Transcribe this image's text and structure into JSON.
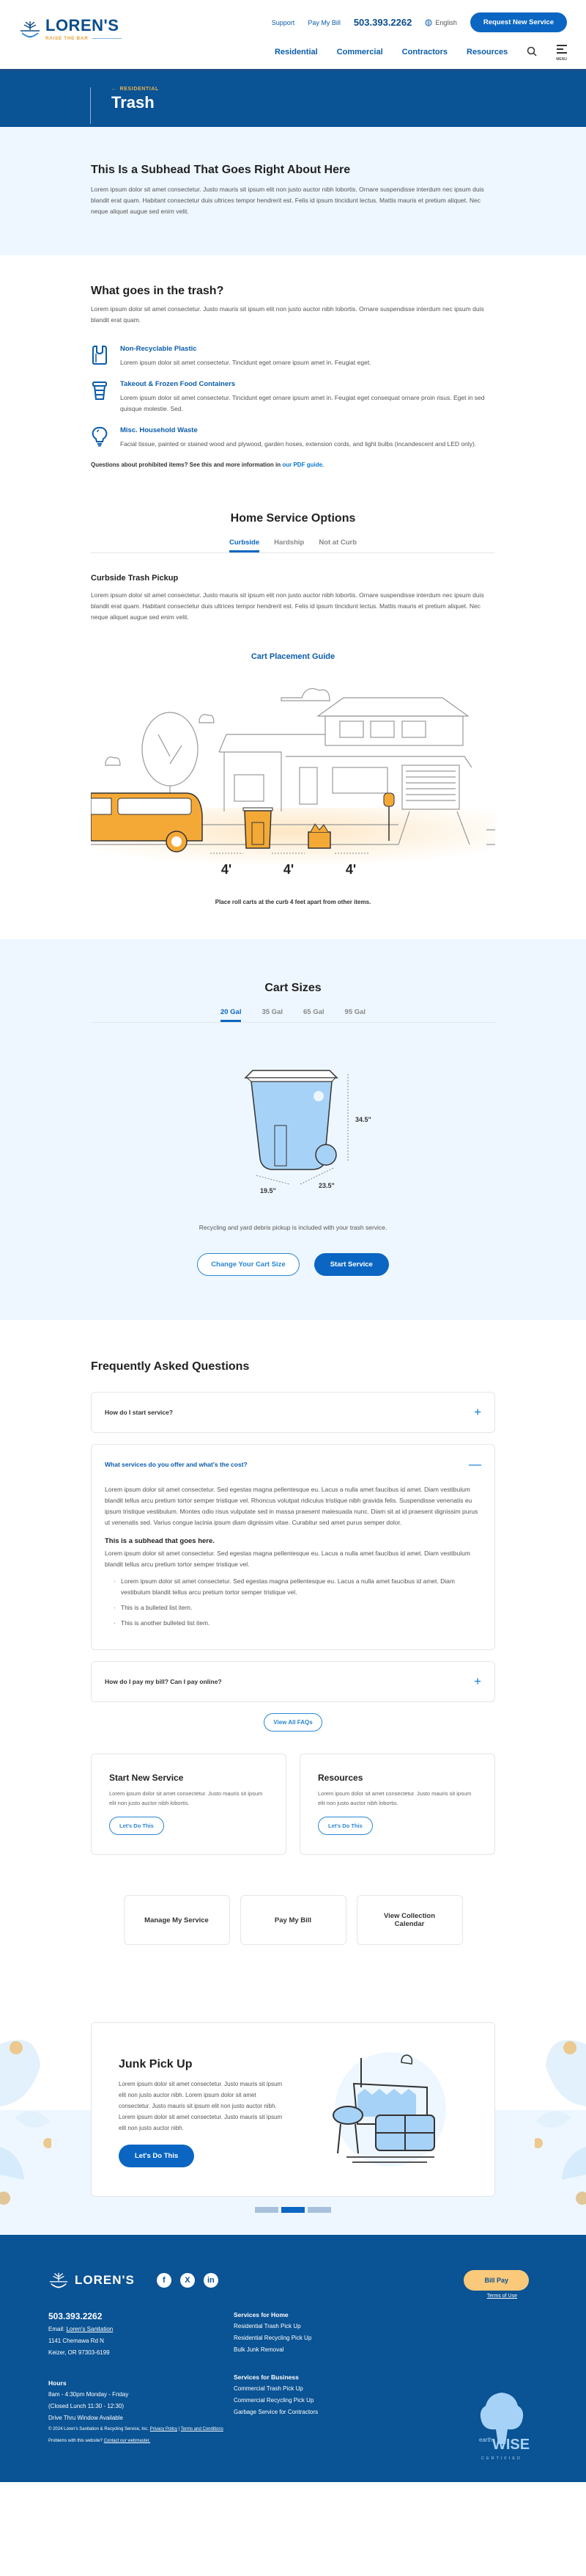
{
  "header": {
    "brand": "LOREN'S",
    "tagline": "RAISE THE BAR",
    "util_links": [
      "Support",
      "Pay My Bill"
    ],
    "phone": "503.393.2262",
    "language": "English",
    "cta": "Request New Service",
    "nav": [
      "Residential",
      "Commercial",
      "Contractors",
      "Resources"
    ],
    "menu_label": "MENU"
  },
  "hero": {
    "breadcrumb": "RESIDENTIAL",
    "title": "Trash"
  },
  "intro": {
    "heading": "This Is a Subhead That Goes Right About Here",
    "body": "Lorem ipsum dolor sit amet consectetur. Justo mauris sit ipsum elit non justo auctor nibh lobortis. Ornare suspendisse interdum nec ipsum duis blandit erat quam. Habitant consectetur duis ultrices tempor hendrerit est. Felis id ipsum tincidunt lectus. Mattis mauris et pretium aliquet. Nec neque aliquet augue sed enim velit."
  },
  "what_goes": {
    "heading": "What goes in the trash?",
    "body": "Lorem ipsum dolor sit amet consectetur. Justo mauris sit ipsum elit non justo auctor nibh lobortis. Ornare suspendisse interdum nec ipsum duis blandit erat quam.",
    "items": [
      {
        "icon": "plastic-bag-icon",
        "title": "Non-Recyclable Plastic",
        "body": "Lorem ipsum dolor sit amet consectetur. Tincidunt eget ornare ipsum amet in. Feugiat eget."
      },
      {
        "icon": "takeout-cup-icon",
        "title": "Takeout & Frozen Food Containers",
        "body": "Lorem ipsum dolor sit amet consectetur. Tincidunt eget ornare ipsum amet in. Feugiat eget consequat ornare proin risus. Eget in sed quisque molestie. Sed."
      },
      {
        "icon": "lightbulb-icon",
        "title": "Misc. Household Waste",
        "body": "Facial tissue, painted or stained wood and plywood, garden hoses, extension cords, and light bulbs (incandescent and LED only)."
      }
    ],
    "note": "Questions about prohibited items? See this and more information in ",
    "note_link": "our PDF guide."
  },
  "home_service": {
    "heading": "Home Service Options",
    "tabs": [
      "Curbside",
      "Hardship",
      "Not at Curb"
    ],
    "active_tab": "Curbside",
    "subheading": "Curbside Trash Pickup",
    "body": "Lorem ipsum dolor sit amet consectetur. Justo mauris sit ipsum elit non justo auctor nibh lobortis. Ornare suspendisse interdum nec ipsum duis blandit erat quam. Habitant consectetur duis ultrices tempor hendrerit est. Felis id ipsum tincidunt lectus. Mattis mauris et pretium aliquet. Nec neque aliquet augue sed enim velit.",
    "guide_title": "Cart Placement Guide",
    "distance_labels": [
      "4'",
      "4'",
      "4'"
    ],
    "caption": "Place roll carts at the curb 4 feet apart from other items."
  },
  "cart_sizes": {
    "heading": "Cart Sizes",
    "tabs": [
      "20 Gal",
      "35 Gal",
      "65 Gal",
      "95 Gal"
    ],
    "active_tab": "20 Gal",
    "height": "34.5\"",
    "width": "19.5\"",
    "depth": "23.5\"",
    "note": "Recycling and yard debris pickup is included with your trash service.",
    "btn_change": "Change Your Cart Size",
    "btn_start": "Start Service"
  },
  "faq": {
    "heading": "Frequently Asked Questions",
    "items": [
      {
        "q": "How do I start service?",
        "open": false
      },
      {
        "q": "What services do you offer and what's the cost?",
        "open": true
      },
      {
        "q": "How do I pay my bill? Can I pay online?",
        "open": false
      }
    ],
    "open_body": {
      "p1": "Lorem ipsum dolor sit amet consectetur. Sed egestas magna pellentesque eu. Lacus a nulla amet faucibus id amet. Diam vestibulum blandit tellus arcu pretium tortor semper tristique vel. Rhoncus volutpat ridiculus tristique nibh gravida felis. Suspendisse venenatis eu ipsum tristique vestibulum. Montes odio risus vulputate sed in massa praesent malesuada nunc. Diam sit at id praesent dignissim purus ut venenatis sed. Varius congue lacinia ipsum diam dignissim vitae. Curabitur sed amet purus semper dolor.",
      "subhead": "This is a subhead that goes here.",
      "p2": "Lorem ipsum dolor sit amet consectetur. Sed egestas magna pellentesque eu. Lacus a nulla amet faucibus id amet. Diam vestibulum blandit tellus arcu pretium tortor semper tristique vel.",
      "bullets": [
        "Lorem ipsum dolor sit amet consectetur. Sed egestas magna pellentesque eu. Lacus a nulla amet faucibus id amet. Diam vestibulum blandit tellus arcu pretium tortor semper tristique vel.",
        "This is a bulleted list item.",
        "This is another bulleted list item."
      ]
    },
    "view_all": "View All FAQs"
  },
  "cards": [
    {
      "title": "Start New Service",
      "body": "Lorem ipsum dolor sit amet consectetur. Justo mauris sit ipsum elit non justo auctor nibh lobortis.",
      "btn": "Let's Do This"
    },
    {
      "title": "Resources",
      "body": "Lorem ipsum dolor sit amet consectetur. Justo mauris sit ipsum elit non justo auctor nibh lobortis.",
      "btn": "Let's Do This"
    }
  ],
  "quick_links": [
    "Manage My Service",
    "Pay My Bill",
    "View Collection Calendar"
  ],
  "junk": {
    "title": "Junk Pick Up",
    "body": "Lorem ipsum dolor sit amet consectetur. Justo mauris sit ipsum elit non justo auctor nibh. Lorem ipsum dolor sit amet consectetur. Justo mauris sit ipsum elit non justo auctor nibh.  Lorem ipsum dolor sit amet consectetur. Justo mauris sit ipsum elit non justo auctor nibh.",
    "btn": "Let's Do This",
    "carousel_total": 3,
    "carousel_active": 2
  },
  "footer": {
    "brand": "LOREN'S",
    "socials": [
      "facebook-icon",
      "x-icon",
      "linkedin-icon"
    ],
    "phone": "503.393.2262",
    "email_label": "Email: ",
    "email_link": "Loren's Sanitation",
    "address1": "1141 Chemawa Rd N",
    "address2": "Keizer, OR 97303-6199",
    "hours_head": "Hours",
    "hours": [
      "8am - 4:30pm Monday - Friday",
      "(Closed Lunch 11:30 - 12:30)",
      "Drive Thru Window Available"
    ],
    "home_head": "Services for Home",
    "home_links": [
      "Residential Trash Pick Up",
      "Residential Recycling Pick Up",
      "Bulk Junk Removal"
    ],
    "biz_head": "Services for Business",
    "biz_links": [
      "Commercial Trash Pick Up",
      "Commercial Recycling Pick Up",
      "Garbage Service for Contractors"
    ],
    "bill_pay": "Bill Pay",
    "terms": "Terms of Use",
    "badge_top": "earth",
    "badge_main": "WISE",
    "badge_sub": "CERTIFIED",
    "copyright": "© 2024 Loren's Sanitation & Recycling Service, Inc.",
    "privacy": "Privacy Policy",
    "conditions": "Terms and Conditions",
    "problems": "Problems with this website? ",
    "webmaster": "Contact our webmaster."
  },
  "colors": {
    "brand_blue": "#0a5394",
    "accent_blue": "#0a66c2",
    "accent_orange": "#e8a23a",
    "light_bg": "#eef7ff",
    "bill_pay": "#fbc97a"
  }
}
